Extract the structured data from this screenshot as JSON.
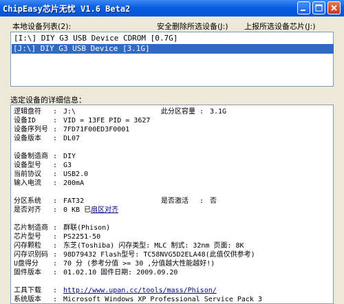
{
  "window": {
    "title": "ChipEasy芯片无忧 V1.6 Beta2"
  },
  "toolbar": {
    "device_list_label": "本地设备列表(2):",
    "safe_remove": "安全删除所选设备(J:)",
    "report_chip": "上报所选设备芯片(J:)"
  },
  "devices": [
    {
      "label": "[I:\\] DIY G3 USB Device  CDROM [0.7G]"
    },
    {
      "label": "[J:\\] DIY G3 USB Device [3.1G]"
    }
  ],
  "details_label": "选定设备的详细信息：",
  "details": {
    "logical_drive": {
      "key": "逻辑盘符",
      "value": "J:\\"
    },
    "partition_capacity": {
      "key": "此分区容量",
      "value": "3.1G"
    },
    "device_id": {
      "key": "设备ID",
      "value": "VID = 13FE     PID = 3627"
    },
    "serial": {
      "key": "设备序列号",
      "value": "7FD71F00ED3F0001"
    },
    "version": {
      "key": "设备版本",
      "value": "DL07"
    },
    "manufacturer": {
      "key": "设备制造商",
      "value": "DIY"
    },
    "model": {
      "key": "设备型号",
      "value": "G3"
    },
    "protocol": {
      "key": "当前协议",
      "value": "USB2.0"
    },
    "current": {
      "key": "输入电流",
      "value": "200mA"
    },
    "filesystem": {
      "key": "分区系统",
      "value": "FAT32"
    },
    "activated": {
      "key": "是否激活",
      "value": "否"
    },
    "aligned": {
      "key": "是否对齐",
      "value": "0 KB 已",
      "link": "扇区对齐"
    },
    "chip_maker": {
      "key": "芯片制造商",
      "value": "群联(Phison)"
    },
    "chip_model": {
      "key": "芯片型号",
      "value": "PS2251-50"
    },
    "flash": {
      "key": "闪存颗粒",
      "value": "东芝(Toshiba)  闪存类型: MLC  制式: 32nm  页面: 8K"
    },
    "flash_id": {
      "key": "闪存识别码",
      "value": "98D79432          Flash型号: TC58NVG5D2ELA48(此值仅供参考)"
    },
    "score": {
      "key": "U盘得分",
      "value": "70 分        (参考分值 >= 30 ,分值越大性能越好!)"
    },
    "firmware": {
      "key": "固件版本",
      "value": "01.02.10      固件日期:  2009.09.20"
    },
    "tool_download": {
      "key": "工具下载",
      "value": "http://www.upan.cc/tools/mass/Phison/"
    },
    "system_version": {
      "key": "系统版本",
      "value": "Microsoft Windows XP Professional Service Pack 3"
    }
  },
  "colors": {
    "titlebar": "#0a5fe0",
    "selection": "#316ac5",
    "window_bg": "#ece9d8",
    "close_button": "#c5371b"
  }
}
